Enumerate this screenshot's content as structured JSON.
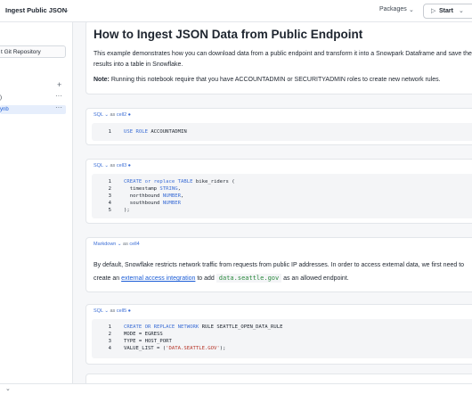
{
  "header": {
    "title": "Ingest Public JSON",
    "title_chevron": "⌄",
    "packages_label": "Packages",
    "packages_chevron": "⌄",
    "start_icon": "▷",
    "start_label": "Start",
    "start_chevron": "⌄"
  },
  "sidebar": {
    "git_label": "t Git Repository",
    "plus_icon": "+",
    "items": [
      {
        "label": ")",
        "menu": "···"
      },
      {
        "label": "ynb",
        "menu": "···"
      }
    ]
  },
  "notebook": {
    "intro": {
      "title": "How to Ingest JSON Data from Public Endpoint",
      "paragraph": "This example demonstrates how you can download data from a public endpoint and transform it into a Snowpark Dataframe and save the results into a table in Snowflake.",
      "note_label": "Note:",
      "note_text": " Running this notebook require that you have ACCOUNTADMIN or SECURITYADMIN roles to create new network rules."
    },
    "cells": [
      {
        "lang": "SQL",
        "lang_chevron": "⌄",
        "as": "as",
        "name": "cell2",
        "dot": "●",
        "lines": [
          {
            "n": "1",
            "parts": [
              {
                "t": "USE ROLE ",
                "c": "kw"
              },
              {
                "t": "ACCOUNTADMIN",
                "c": "tx"
              }
            ]
          }
        ]
      },
      {
        "lang": "SQL",
        "lang_chevron": "⌄",
        "as": "as",
        "name": "cell3",
        "dot": "●",
        "lines": [
          {
            "n": "1",
            "parts": [
              {
                "t": "CREATE ",
                "c": "kw"
              },
              {
                "t": "or ",
                "c": "kw"
              },
              {
                "t": "replace ",
                "c": "kw"
              },
              {
                "t": "TABLE ",
                "c": "kw"
              },
              {
                "t": "bike_riders (",
                "c": "tx"
              }
            ]
          },
          {
            "n": "2",
            "parts": [
              {
                "t": "  timestamp ",
                "c": "tx"
              },
              {
                "t": "STRING",
                "c": "ty"
              },
              {
                "t": ",",
                "c": "tx"
              }
            ]
          },
          {
            "n": "3",
            "parts": [
              {
                "t": "  northbound ",
                "c": "tx"
              },
              {
                "t": "NUMBER",
                "c": "ty"
              },
              {
                "t": ",",
                "c": "tx"
              }
            ]
          },
          {
            "n": "4",
            "parts": [
              {
                "t": "  southbound ",
                "c": "tx"
              },
              {
                "t": "NUMBER",
                "c": "ty"
              }
            ]
          },
          {
            "n": "5",
            "parts": [
              {
                "t": ");",
                "c": "tx"
              }
            ]
          }
        ]
      },
      {
        "lang": "SQL",
        "lang_chevron": "⌄",
        "as": "as",
        "name": "cell5",
        "dot": "●",
        "lines": [
          {
            "n": "1",
            "parts": [
              {
                "t": "CREATE OR REPLACE NETWORK ",
                "c": "kw"
              },
              {
                "t": "RULE SEATTLE_OPEN_DATA_RULE",
                "c": "tx"
              }
            ]
          },
          {
            "n": "2",
            "parts": [
              {
                "t": "MODE = EGRESS",
                "c": "tx"
              }
            ]
          },
          {
            "n": "3",
            "parts": [
              {
                "t": "TYPE = HOST_PORT",
                "c": "tx"
              }
            ]
          },
          {
            "n": "4",
            "parts": [
              {
                "t": "VALUE_LIST = (",
                "c": "tx"
              },
              {
                "t": "'DATA.SEATTLE.GOV'",
                "c": "st"
              },
              {
                "t": ");",
                "c": "tx"
              }
            ]
          }
        ]
      }
    ],
    "markdown_cell": {
      "lang": "Markdown",
      "lang_chevron": "⌄",
      "as": "as",
      "name": "cell4",
      "text_before": "By default, Snowflake restricts network traffic from requests from public IP addresses. In order to access external data, we first need to create an ",
      "link": "external access integration",
      "text_mid": " to add ",
      "code": "data.seattle.gov",
      "text_after": " as an allowed endpoint."
    },
    "ghost_head": "SQL ⌄  as  ..."
  },
  "footer": {
    "chevron": "⌄"
  },
  "colors": {
    "accent": "#1a5cd6",
    "keyword": "#3d6fd6",
    "string": "#b7362a",
    "code_chip": "#2c8a3e"
  }
}
